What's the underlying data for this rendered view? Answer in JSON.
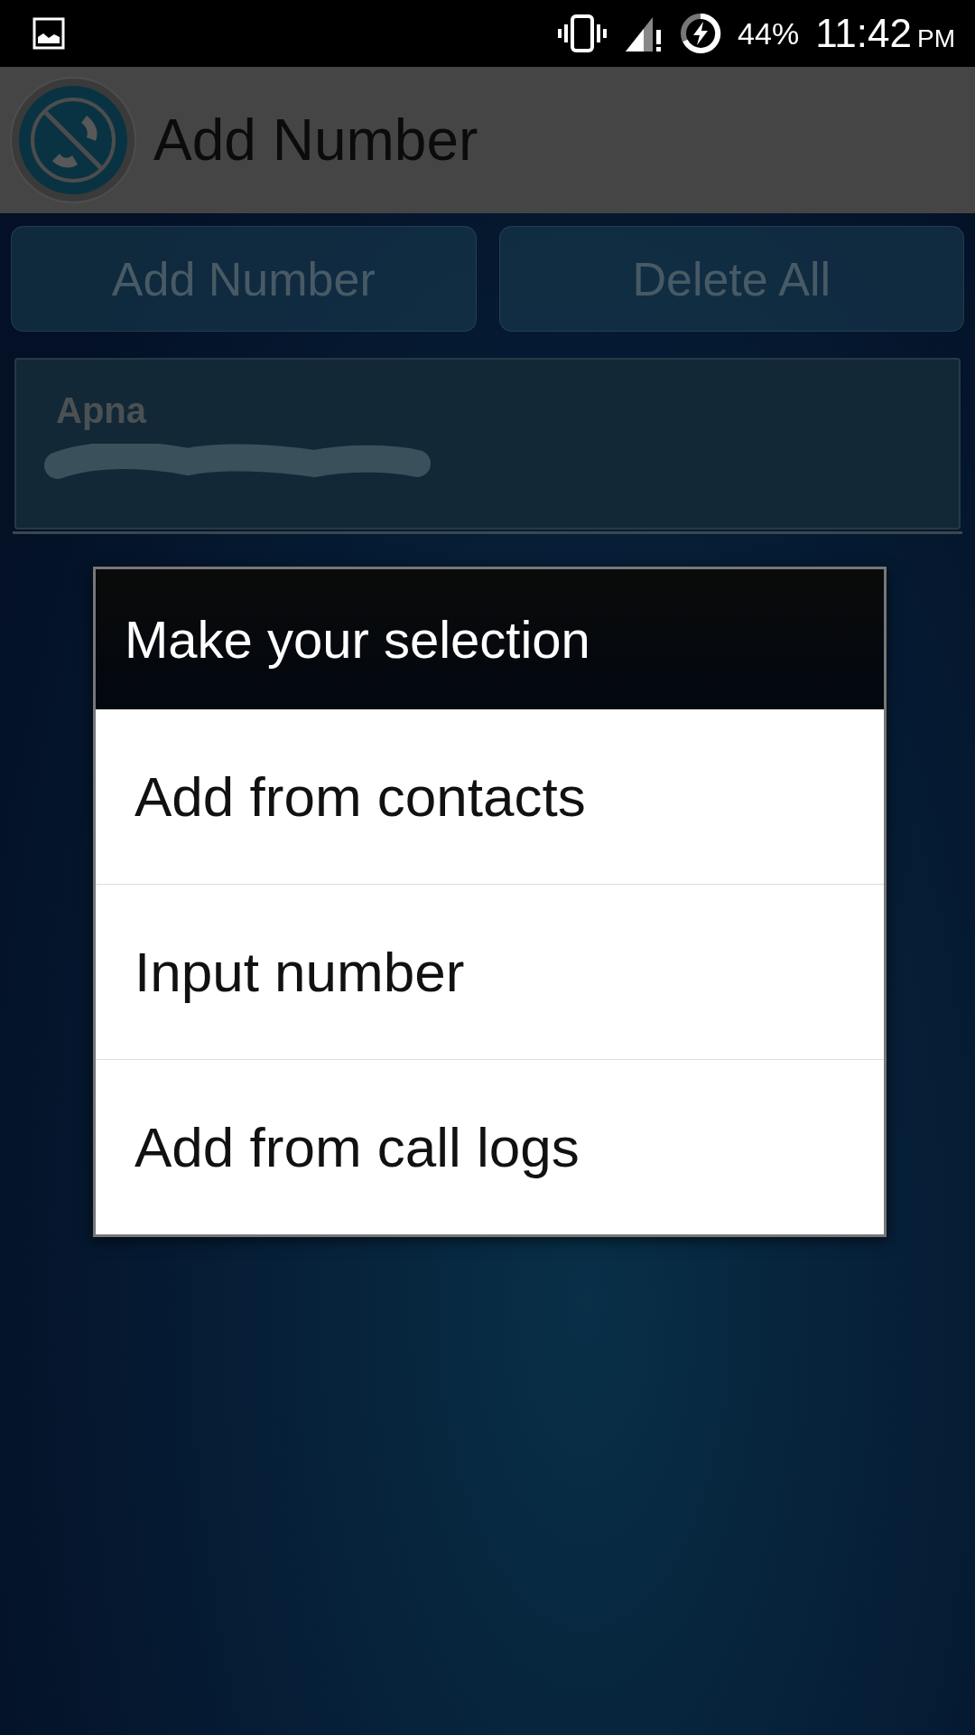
{
  "status_bar": {
    "battery": "44%",
    "time": "11:42",
    "meridiem": "PM"
  },
  "app_bar": {
    "title": "Add Number"
  },
  "buttons": [
    {
      "label": "Add Number"
    },
    {
      "label": "Delete All"
    }
  ],
  "contacts": [
    {
      "name": "Apna",
      "number_redacted": true
    }
  ],
  "dialog": {
    "title": "Make your selection",
    "options": [
      {
        "label": "Add from contacts"
      },
      {
        "label": "Input number"
      },
      {
        "label": "Add from call logs"
      }
    ]
  }
}
